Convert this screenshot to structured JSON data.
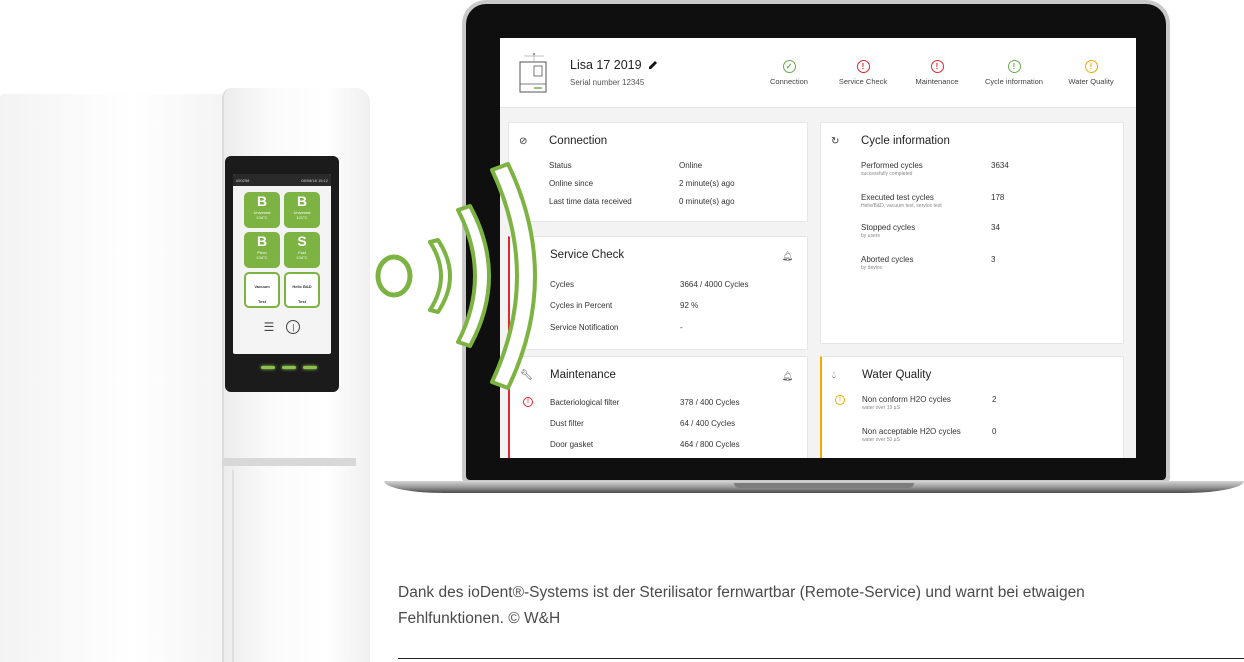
{
  "device_screen": {
    "id_text": "#50258",
    "date_text": "08/08/18",
    "time_text": "15:12",
    "programs": [
      {
        "letter": "B",
        "name": "Universal",
        "temp": "134°C"
      },
      {
        "letter": "B",
        "name": "Universal",
        "temp": "121°C"
      },
      {
        "letter": "B",
        "name": "Prion",
        "temp": "134°C"
      },
      {
        "letter": "S",
        "name": "Fast",
        "temp": "134°C"
      }
    ],
    "tests": [
      {
        "line1": "Vacuum",
        "line2": "Test"
      },
      {
        "line1": "Helix B&D",
        "line2": "Test"
      }
    ]
  },
  "dashboard": {
    "device_name": "Lisa 17 2019",
    "serial": "Serial number 12345",
    "status_items": [
      {
        "label": "Connection",
        "state": "ok"
      },
      {
        "label": "Service Check",
        "state": "error"
      },
      {
        "label": "Maintenance",
        "state": "error"
      },
      {
        "label": "Cycle information",
        "state": "ok"
      },
      {
        "label": "Water Quality",
        "state": "warning"
      }
    ],
    "connection": {
      "title": "Connection",
      "rows": [
        {
          "label": "Status",
          "value": "Online"
        },
        {
          "label": "Online since",
          "value": "2 minute(s) ago"
        },
        {
          "label": "Last time data received",
          "value": "0 minute(s) ago"
        }
      ]
    },
    "service_check": {
      "title": "Service Check",
      "rows": [
        {
          "label": "Cycles",
          "value": "3664 / 4000 Cycles"
        },
        {
          "label": "Cycles in Percent",
          "value": "92 %"
        },
        {
          "label": "Service Notification",
          "value": "-"
        }
      ]
    },
    "maintenance": {
      "title": "Maintenance",
      "rows": [
        {
          "label": "Bacteriological filter",
          "value": "378 / 400 Cycles"
        },
        {
          "label": "Dust filter",
          "value": "64 / 400 Cycles"
        },
        {
          "label": "Door gasket",
          "value": "464 / 800 Cycles"
        }
      ]
    },
    "cycle_information": {
      "title": "Cycle information",
      "rows": [
        {
          "label": "Performed cycles",
          "sub": "successfully completed",
          "value": "3634"
        },
        {
          "label": "Executed test cycles",
          "sub": "Helix/B&D, vacuum test, service test",
          "value": "178"
        },
        {
          "label": "Stopped cycles",
          "sub": "by users",
          "value": "34"
        },
        {
          "label": "Aborted cycles",
          "sub": "by device",
          "value": "3"
        }
      ]
    },
    "water_quality": {
      "title": "Water Quality",
      "rows": [
        {
          "label": "Non conform H2O cycles",
          "sub": "water over 15 µS",
          "value": "2"
        },
        {
          "label": "Non acceptable H2O cycles",
          "sub": "water over 50 µS",
          "value": "0"
        }
      ]
    }
  },
  "caption": {
    "line1": "Dank des ioDent®-Systems ist der Sterilisator fernwartbar (Remote-Service) und warnt bei etwaigen",
    "line2": "Fehlfunktionen. © W&H"
  },
  "colors": {
    "ok": "#6aa84f",
    "error": "#e0282e",
    "warning": "#f2a900",
    "brand_green": "#7cb342"
  }
}
